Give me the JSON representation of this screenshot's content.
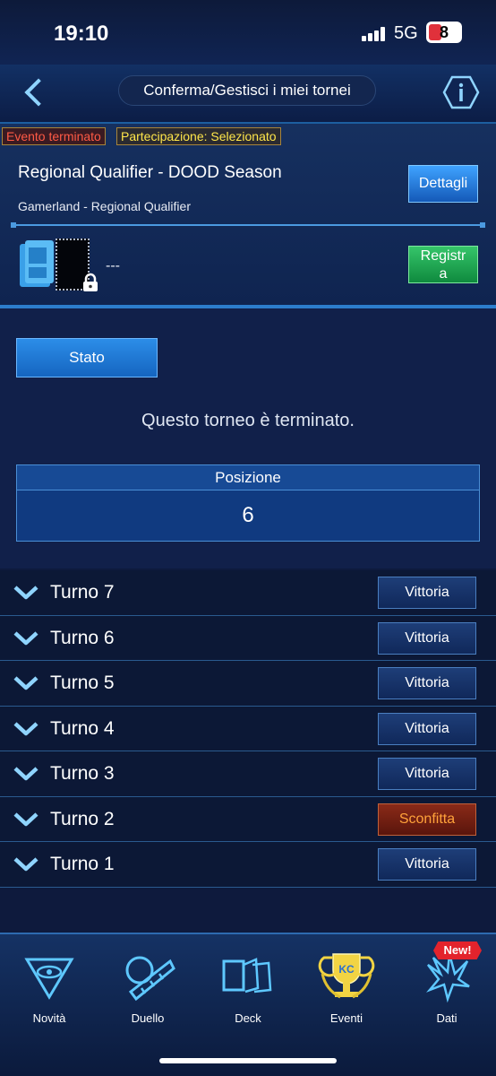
{
  "status_bar": {
    "time": "19:10",
    "network": "5G",
    "battery": "8"
  },
  "header": {
    "title": "Conferma/Gestisci i miei tornei"
  },
  "event": {
    "tag_ended": "Evento terminato",
    "tag_participation": "Partecipazione: Selezionato",
    "name": "Regional Qualifier - DOOD Season",
    "subtitle": "Gamerland - Regional Qualifier",
    "details_label": "Dettagli",
    "deck_name": "---",
    "register_line1": "Registr",
    "register_line2": "a"
  },
  "main": {
    "stato_label": "Stato",
    "ended_message": "Questo torneo è terminato.",
    "position_header": "Posizione",
    "position_value": "6"
  },
  "rounds": [
    {
      "label": "Turno 7",
      "result": "Vittoria",
      "status": "win"
    },
    {
      "label": "Turno 6",
      "result": "Vittoria",
      "status": "win"
    },
    {
      "label": "Turno 5",
      "result": "Vittoria",
      "status": "win"
    },
    {
      "label": "Turno 4",
      "result": "Vittoria",
      "status": "win"
    },
    {
      "label": "Turno 3",
      "result": "Vittoria",
      "status": "win"
    },
    {
      "label": "Turno 2",
      "result": "Sconfitta",
      "status": "loss"
    },
    {
      "label": "Turno 1",
      "result": "Vittoria",
      "status": "win"
    }
  ],
  "navbar": {
    "items": [
      {
        "label": "Novità",
        "icon": "millennium-eye-icon"
      },
      {
        "label": "Duello",
        "icon": "duel-disk-icon"
      },
      {
        "label": "Deck",
        "icon": "deck-cards-icon"
      },
      {
        "label": "Eventi",
        "icon": "trophy-icon"
      },
      {
        "label": "Dati",
        "icon": "dragon-icon"
      }
    ],
    "new_badge": "New!"
  },
  "colors": {
    "accent": "#2c8de8",
    "win": "#1e3e78",
    "loss": "#8a2a18",
    "loss_text": "#ffa23a"
  }
}
